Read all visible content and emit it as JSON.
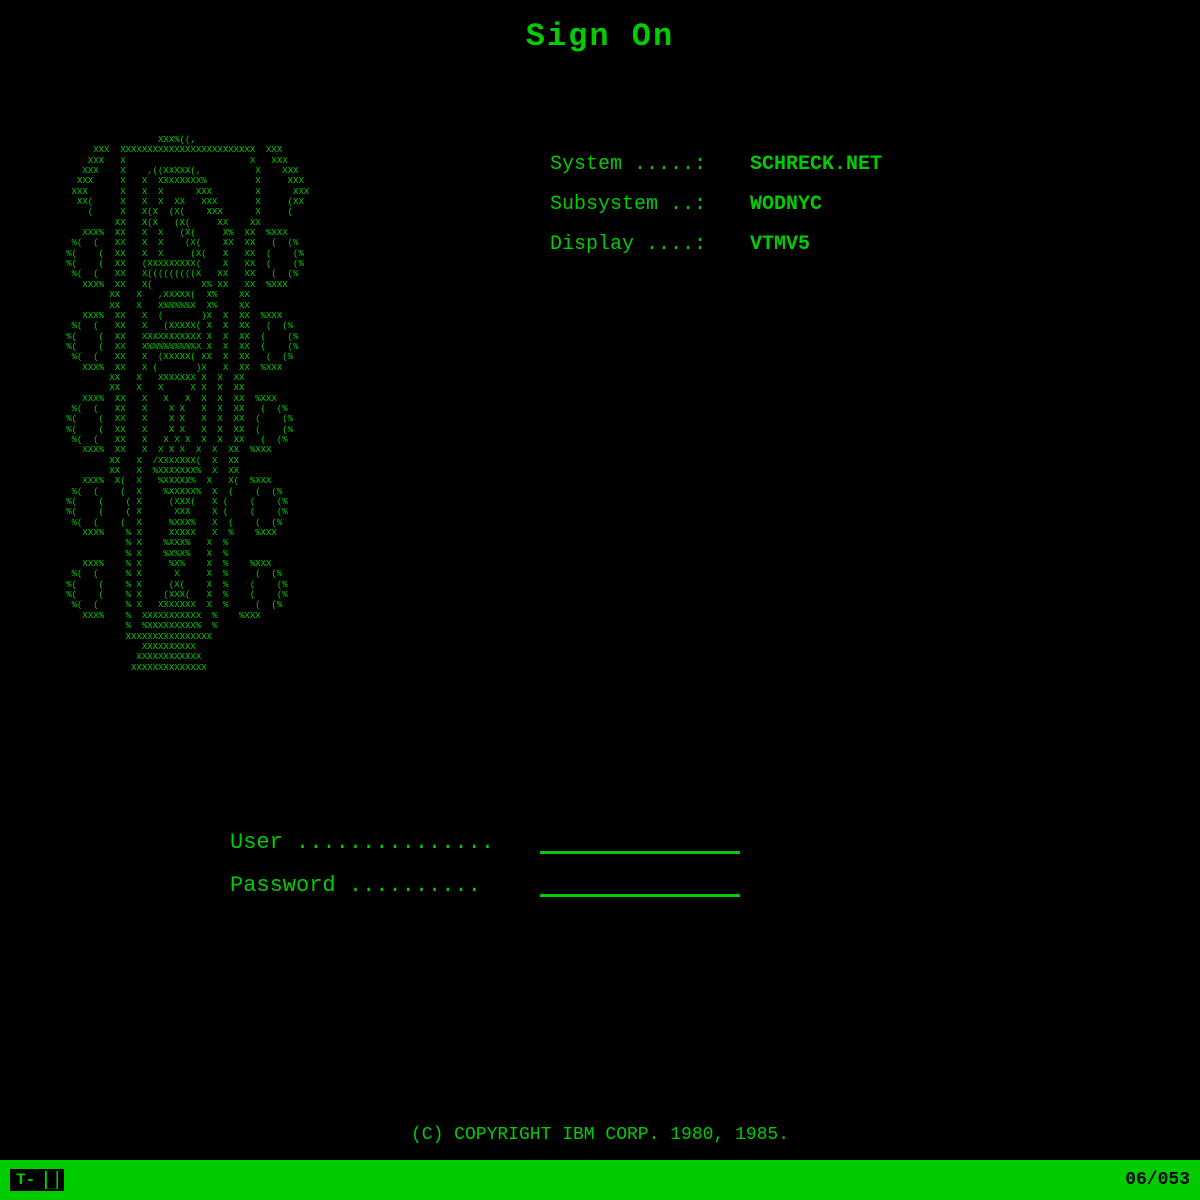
{
  "title": "Sign On",
  "system_info": {
    "system_label": "System .....: ",
    "system_value": "SCHRECK.NET",
    "subsystem_label": "Subsystem ..: ",
    "subsystem_value": "WODNYC",
    "display_label": "Display ....: ",
    "display_value": "VTMV5"
  },
  "login": {
    "user_label": "User ...............",
    "password_label": "Password ..........",
    "user_placeholder": "",
    "password_placeholder": ""
  },
  "copyright": "(C) COPYRIGHT IBM CORP. 1980, 1985.",
  "status_bar": {
    "left": "T-",
    "right": "06/053"
  },
  "ascii_art": "  XXX%((,\n XXX%  %%%((((((((((((((((%%%  %XXX\n  XXX%  %X   CK (.         X  %XXX\n   XXX%  %X    (XXXXX(,       X  %XXX\n    XXX%  %X   X  %%%%%XXX    X  %XXX\n     XXX%  %X  X  %  (%XXXX%  X  %XXX\n      %%(  %X  X % X   %XXXX% X  %((\n        (  %X  X(% ((    %XXX% X  (\n           %X  X(%  ((     %XX% X\n      XXX%  %X  X %  (       %X% X  %XXX\n    %(   (  %X  X %   (       (% X  (   (%\n   %(     (  %X  X  % (        ( X  (     (%\n   %(     (  %X  (XXXXX(,       X  (     (%\n    %(   (  %X  X((((((((X     X  (   (%\n      XXX%  %X  X(         %X% X  %XXX\n           %X  X  (XXXXX(  %X% X\n           %X  X  X%%%%%X  %X% X\n      XXX%  %X  X (     ) X  (  X  %XXX\n    %(   (  %X  X  (XXX(  X  (  X  (   (%\n   %(     (  %X  XXXXXXXXX  (  X  (     (%\n   %(     (  %X  X%%%%%%%X  (  X  (     (%\n    %(   (  %X  X  (XXX(  X  (  X  (   (%\n      XXX%  %X  X (     ) X  (  X  %XXX\n           %X  X  XXXXX  X  X  (% X\n           %X  X  X   X  X  X  (% X\n      XXX%  %X  X  X X  X  X  X  %XXX\n    %(   (  %X  X   X   X  X  X  (   (%\n   %(     (  %X  X  X  X  X  X  (     (%\n   %(     (  %X  X  X  X  X  X  (     (%\n    %(   (  %X  X  X X  X  X  X  (   (%\n      XXX%  %X  X  X X  X  X  X  %XXX\n           %X  X  /XXXXX(  X  X  (% X\n           %X  X  %XXXXX%  X  X  (% X\n      XXX%  %(  X  %XXX%  X  X  %XXX\n    %(   (   (  X    %X%    X  (   (%\n   %(     (   (  X   (X(   X  (     (%\n   %(     (   (  X   XXX   X  (     (%\n    %(   (   (  X  %XXX%  X  (   (%\n      XXX%   %  X  XXXXX  X  %  %XXX\n             %  X  %XXX%  X  %\n             %  X  %X%X%  X  %\n      XXX%   %  X   %X%   X  %  %XXX\n    %(   (   %  X    X    X  %  (   (%\n   %(     (  %  X   (X(   X  %  (     (%\n   %(     (  %  X  (XXX(  X  %  (     (%\n    %(   (   %  X XXXXXXX X  %  (   (%\n      XXX%   %  XXXXXXXXXX  %  %XXX\n             %  %XXXXXXXXX  %\n             XXXXXXXXXXXXXX\n                XXXXXXXXX\n               XXXXXXXXXXX\n              XXXXXXXXXXXXXX"
}
